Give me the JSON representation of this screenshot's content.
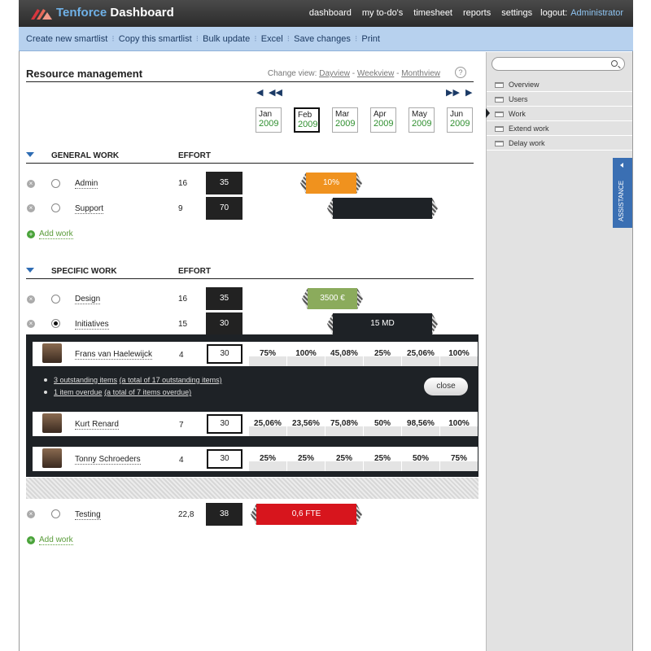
{
  "header": {
    "brand_part1": "Tenforce",
    "brand_part2": "Dashboard",
    "nav": [
      "dashboard",
      "my to-do's",
      "timesheet",
      "reports",
      "settings"
    ],
    "logout_label": "logout:",
    "user": "Administrator"
  },
  "toolbar": [
    "Create new smartlist",
    "Copy this smartlist",
    "Bulk update",
    "Excel",
    "Save changes",
    "Print"
  ],
  "page": {
    "title": "Resource management",
    "change_view_label": "Change view:",
    "views": [
      "Dayview",
      "Weekview",
      "Monthview"
    ],
    "help": "?"
  },
  "months": [
    {
      "m": "Jan",
      "y": "2009"
    },
    {
      "m": "Feb",
      "y": "2009"
    },
    {
      "m": "Mar",
      "y": "2009"
    },
    {
      "m": "Apr",
      "y": "2009"
    },
    {
      "m": "May",
      "y": "2009"
    },
    {
      "m": "Jun",
      "y": "2009"
    }
  ],
  "selected_month": "Feb",
  "general": {
    "heading": "GENERAL WORK",
    "effort_heading": "EFFORT",
    "rows": [
      {
        "name": "Admin",
        "effort": "16",
        "value": "35",
        "bar_label": "10%",
        "bar_color": "#f0921e"
      },
      {
        "name": "Support",
        "effort": "9",
        "value": "70",
        "bar_label": "",
        "bar_color": "#1e2226"
      }
    ],
    "add_label": "Add work"
  },
  "specific": {
    "heading": "SPECIFIC WORK",
    "effort_heading": "EFFORT",
    "rows": [
      {
        "name": "Design",
        "effort": "16",
        "value": "35",
        "bar_label": "3500 €",
        "bar_color": "#8bab5c"
      },
      {
        "name": "Initiatives",
        "effort": "15",
        "value": "30",
        "bar_label": "15 MD",
        "bar_color": "#1e2226"
      }
    ],
    "people": [
      {
        "name": "Frans van Haelewijck",
        "effort": "4",
        "value": "30",
        "pcts": [
          "75%",
          "100%",
          "45,08%",
          "25%",
          "25,06%",
          "100%"
        ]
      },
      {
        "name": "Kurt Renard",
        "effort": "7",
        "value": "30",
        "pcts": [
          "25,06%",
          "23,56%",
          "75,08%",
          "50%",
          "98,56%",
          "100%"
        ]
      },
      {
        "name": "Tonny Schroeders",
        "effort": "4",
        "value": "30",
        "pcts": [
          "25%",
          "25%",
          "25%",
          "25%",
          "50%",
          "75%"
        ]
      }
    ],
    "info": [
      {
        "link": "3 outstanding items",
        "rest": "(a total of 17 outstanding items)"
      },
      {
        "link": "1 item overdue",
        "rest": "(a total of 7 items overdue)"
      }
    ],
    "close_label": "close",
    "testing": {
      "name": "Testing",
      "effort": "22,8",
      "value": "38",
      "bar_label": "0,6 FTE",
      "bar_color": "#d7151d"
    },
    "add_label": "Add work"
  },
  "sidebar": {
    "items": [
      "Overview",
      "Users",
      "Work",
      "Extend work",
      "Delay work"
    ],
    "assistance": "ASSISTANCE"
  },
  "colors": {
    "accent_blue": "#3a6fb3",
    "toolbar_bg": "#b7d1ee",
    "header_bg": "#2b2b2b",
    "green": "#2f8f2f"
  }
}
